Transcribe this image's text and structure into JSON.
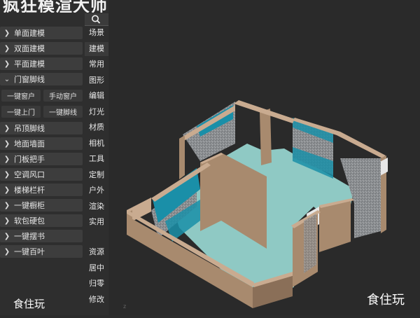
{
  "app": {
    "title": "疯狂模渲大师"
  },
  "menu": {
    "items": [
      {
        "label": "单面建模",
        "chevron": "chevron-right-icon"
      },
      {
        "label": "双面建模",
        "chevron": "chevron-right-icon"
      },
      {
        "label": "平面建模",
        "chevron": "chevron-right-icon"
      },
      {
        "label": "门窗脚线",
        "chevron": "chevron-down-icon"
      }
    ],
    "sub_buttons": [
      "一键窗户",
      "手动窗户",
      "一键上门",
      "一键脚线"
    ],
    "items_after": [
      "吊顶脚线",
      "地面墙面",
      "门板把手",
      "空调风口",
      "楼梯栏杆",
      "一键橱柜",
      "软包硬包",
      "一键摆书",
      "一键百叶"
    ]
  },
  "categories": [
    "场景",
    "建模",
    "常用",
    "图形",
    "编辑",
    "灯光",
    "材质",
    "相机",
    "工具",
    "定制",
    "户外",
    "渲染",
    "实用"
  ],
  "categories_bottom": [
    "资源",
    "居中",
    "归零",
    "修改"
  ],
  "watermark": {
    "panel": "食住玩",
    "viewport": "食住玩"
  },
  "colors": {
    "panel_bg": "#2e2e2e",
    "button_bg": "#3d3d3d",
    "viewport_bg": "#2a2a2a",
    "wall": "#a88a6e",
    "floor": "#8fc9c4",
    "window_teal": "#1a8fa8"
  }
}
